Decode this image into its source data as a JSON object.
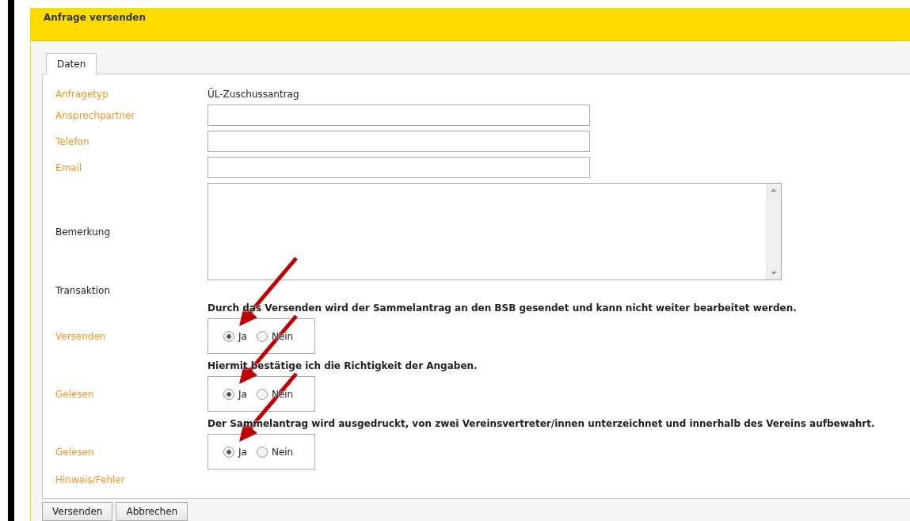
{
  "dialog": {
    "title": "Anfrage versenden"
  },
  "tabs": [
    {
      "label": "Daten",
      "selected": true
    }
  ],
  "rows": [
    {
      "kind": "text",
      "label": "Anfragetyp",
      "highlighted": true,
      "value": "ÜL-Zuschussantrag"
    },
    {
      "kind": "input",
      "label": "Ansprechpartner",
      "highlighted": true
    },
    {
      "kind": "input",
      "label": "Telefon",
      "highlighted": true
    },
    {
      "kind": "input",
      "label": "Email",
      "highlighted": true
    },
    {
      "kind": "textarea",
      "label": "Bemerkung",
      "highlighted": false
    },
    {
      "kind": "text",
      "label": "Transaktion",
      "highlighted": false
    },
    {
      "kind": "radio",
      "label": "Versenden",
      "highlighted": true,
      "notice": "Durch das Versenden wird der Sammelantrag an den BSB gesendet und kann nicht weiter bearbeitet werden.",
      "arrow": true,
      "options": [
        {
          "label": "Ja",
          "selected": true
        },
        {
          "label": "Nein",
          "selected": false
        }
      ]
    },
    {
      "kind": "radio",
      "label": "Gelesen",
      "highlighted": true,
      "notice": "Hiermit bestätige ich die Richtigkeit der Angaben.",
      "arrow": true,
      "options": [
        {
          "label": "Ja",
          "selected": true
        },
        {
          "label": "Nein",
          "selected": false
        }
      ]
    },
    {
      "kind": "radio",
      "label": "Gelesen",
      "highlighted": true,
      "notice": "Der Sammelantrag wird ausgedruckt, von zwei Vereinsvertreter/innen unterzeichnet und innerhalb des Vereins aufbewahrt.",
      "arrow": true,
      "options": [
        {
          "label": "Ja",
          "selected": true
        },
        {
          "label": "Nein",
          "selected": false
        }
      ]
    },
    {
      "kind": "text",
      "label": "Hinweis/Fehler",
      "highlighted": true
    }
  ],
  "buttons": [
    "Versenden",
    "Abbrechen"
  ]
}
